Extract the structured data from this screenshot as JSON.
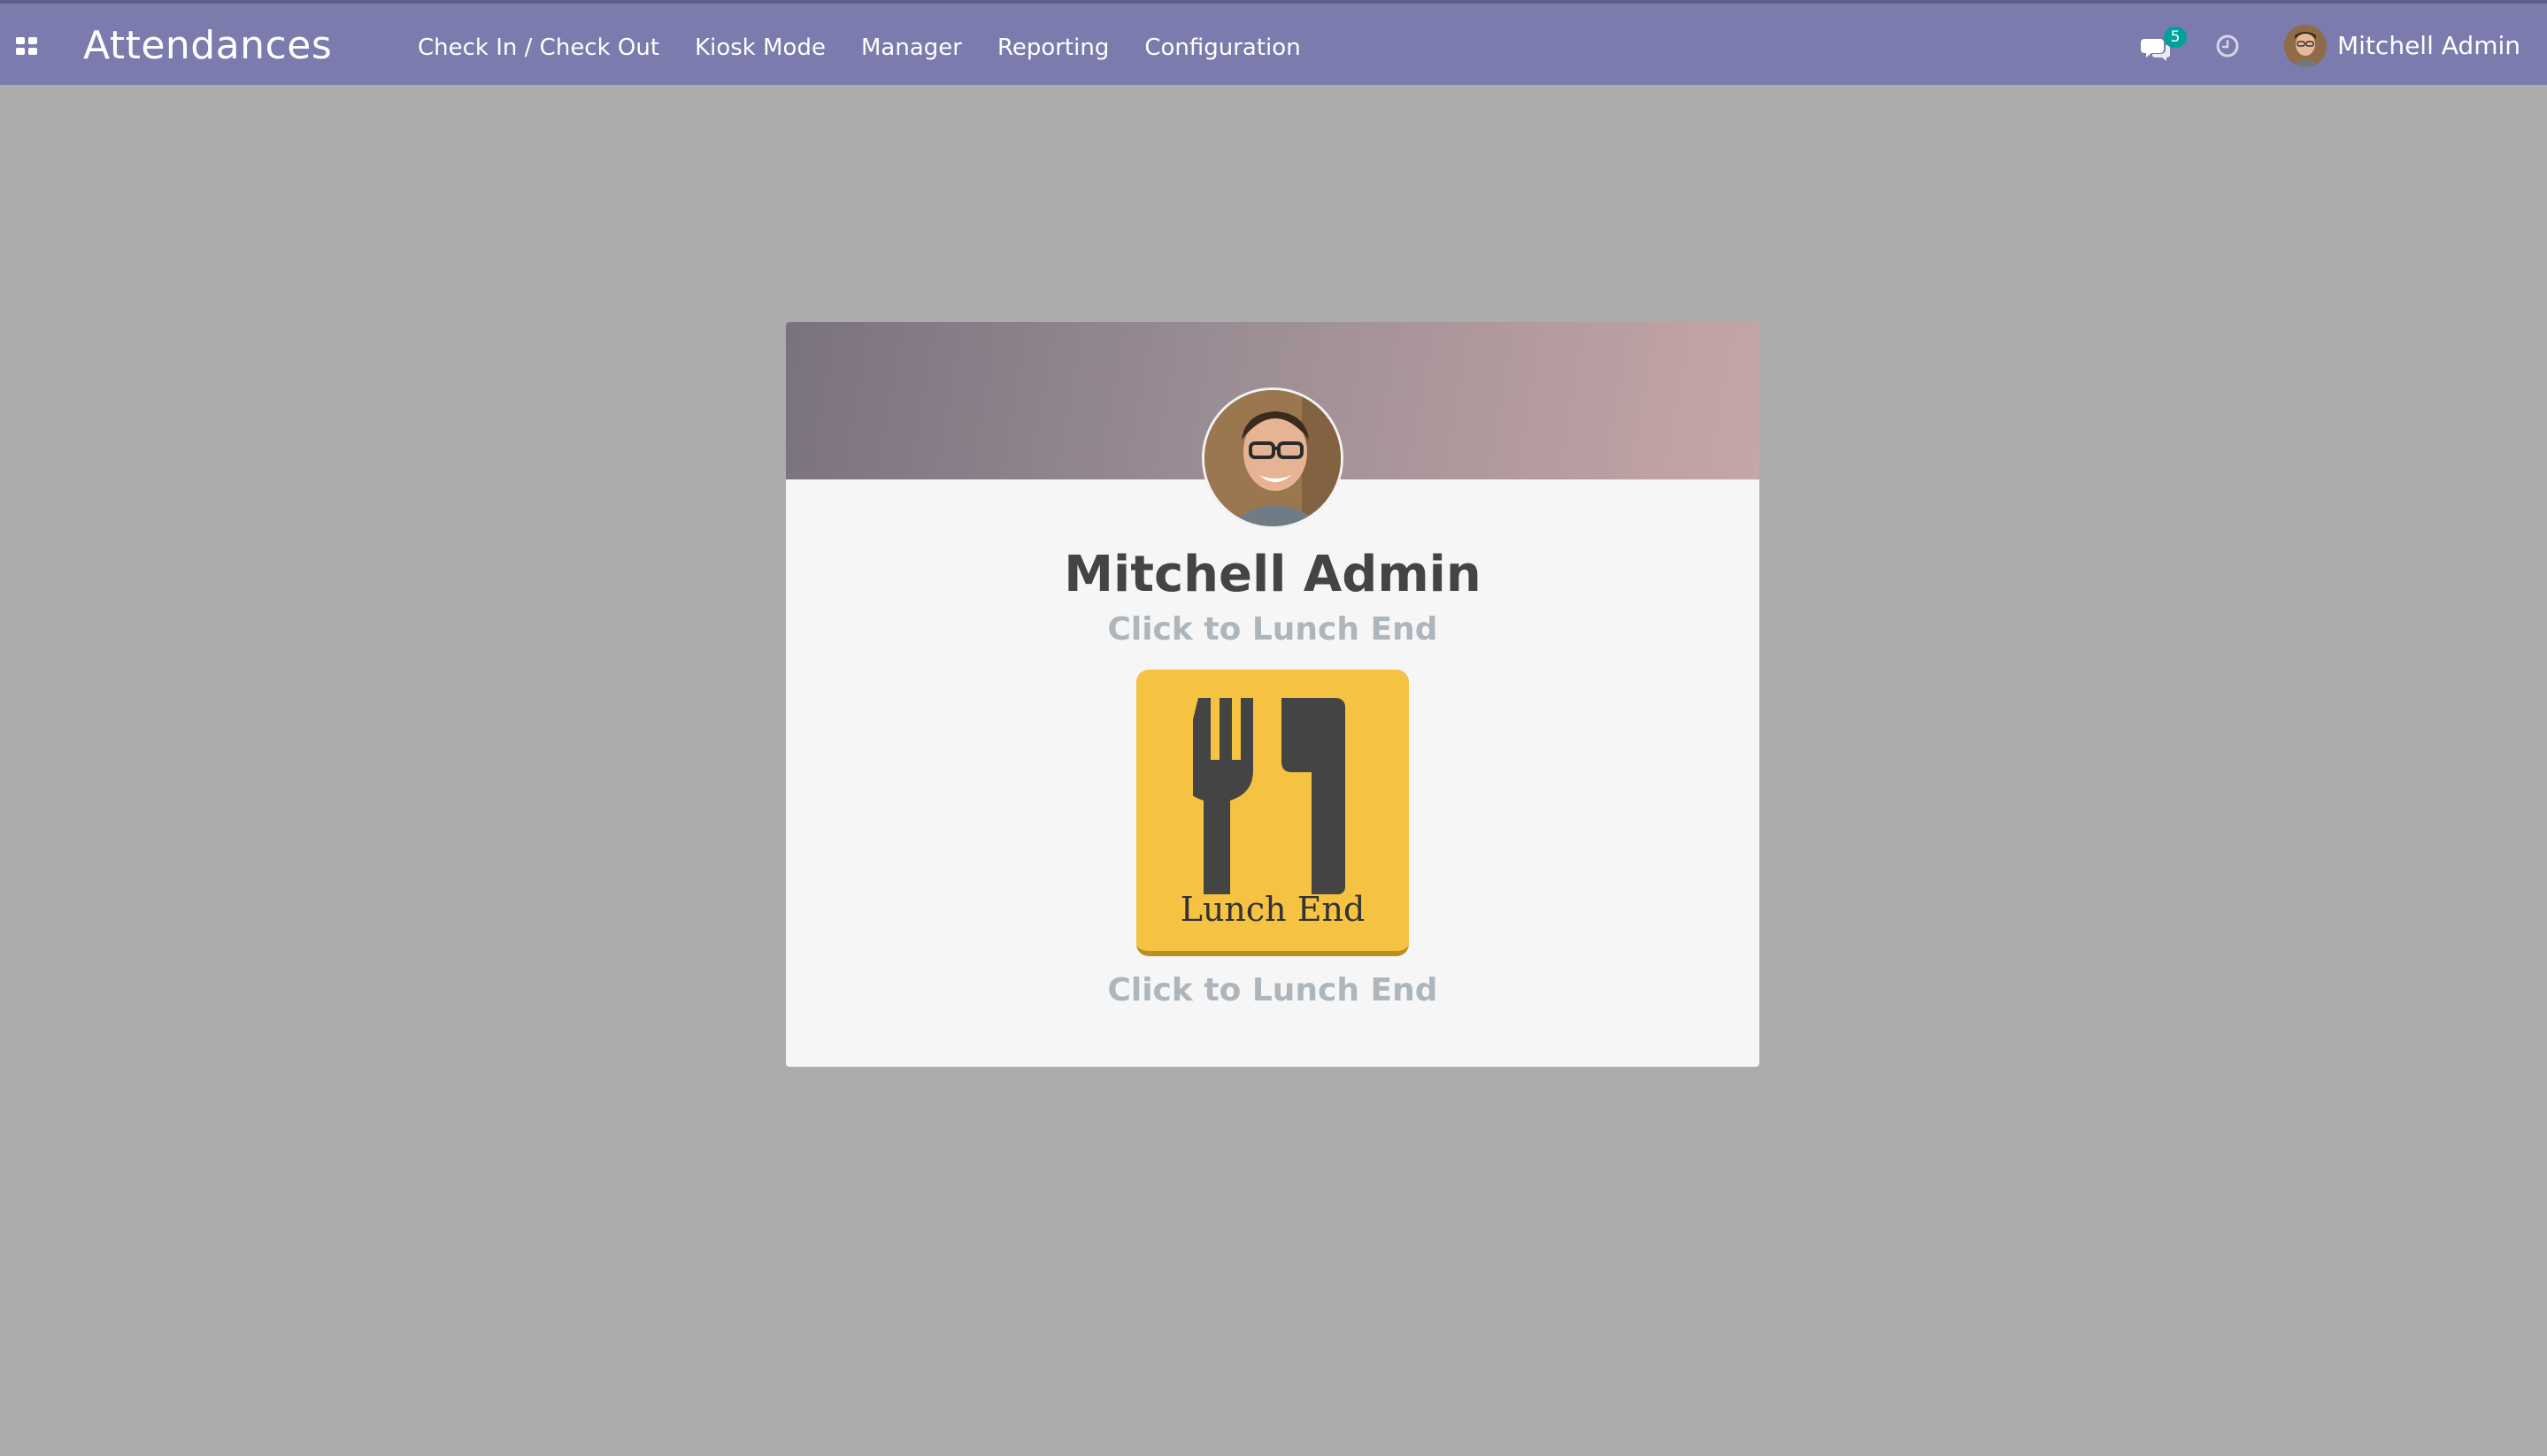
{
  "navbar": {
    "app_title": "Attendances",
    "menu": [
      {
        "label": "Check In / Check Out"
      },
      {
        "label": "Kiosk Mode"
      },
      {
        "label": "Manager"
      },
      {
        "label": "Reporting"
      },
      {
        "label": "Configuration"
      }
    ],
    "messages_badge": "5",
    "user_name": "Mitchell Admin",
    "icons": {
      "apps": "apps-grid-icon",
      "messages": "chat-bubbles-icon",
      "activities": "clock-icon"
    }
  },
  "card": {
    "employee_name": "Mitchell Admin",
    "hint_top": "Click to Lunch End",
    "button_label": "Lunch End",
    "button_icon": "fork-knife-icon",
    "hint_bottom": "Click to Lunch End"
  },
  "colors": {
    "navbar": "#7c7bad",
    "page_background": "#acacac",
    "button": "#f5c242",
    "badge": "#00a09d"
  }
}
